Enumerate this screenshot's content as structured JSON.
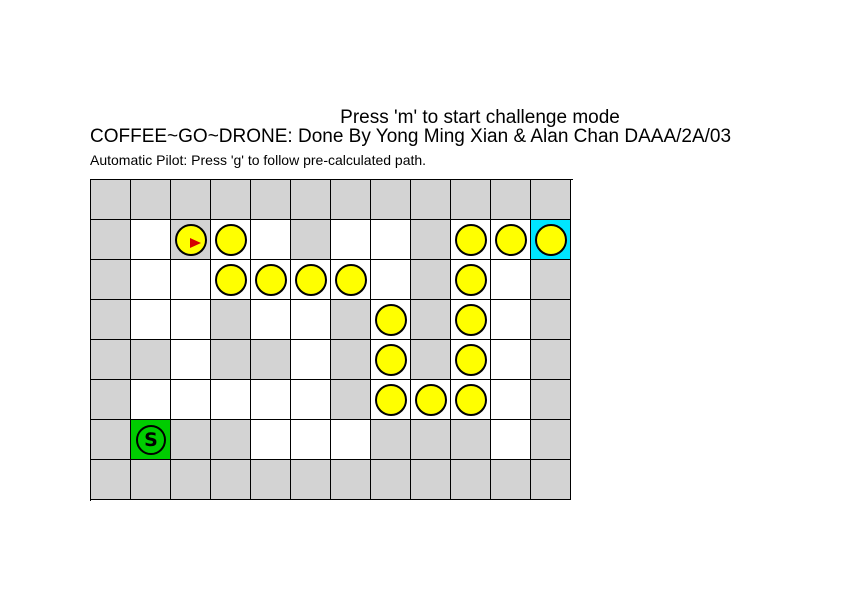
{
  "header": {
    "challenge_prompt": "Press 'm' to start challenge mode",
    "app_title": "COFFEE~GO~DRONE: Done By Yong Ming Xian & Alan Chan DAAA/2A/03",
    "pilot_hint": "Automatic Pilot: Press 'g' to follow pre-calculated path."
  },
  "legend": {
    "start_label": "S"
  },
  "colors": {
    "wall": "#d3d3d3",
    "open": "#ffffff",
    "start": "#00cc00",
    "goal": "#00e5ff",
    "path_marker": "#ffff00",
    "drone": "#d40000"
  },
  "icons": {
    "path_marker": "yellow-circle",
    "drone": "red-arrow-right",
    "start": "circled-s"
  },
  "maze": {
    "rows": [
      "XXXXXXXXXXXX",
      "X.DP.X..XPPE",
      "X..PPPP.XP.X",
      "X..X..XPXP.X",
      "XX.XX.XPXP.X",
      "X.....XPPP.X",
      "XSXX...XXX.X",
      "XXXXXXXXXXXX"
    ],
    "cell_legend": {
      "X": "wall",
      ".": "open",
      "S": "start",
      "E": "goal",
      "P": "path",
      "D": "drone"
    }
  }
}
